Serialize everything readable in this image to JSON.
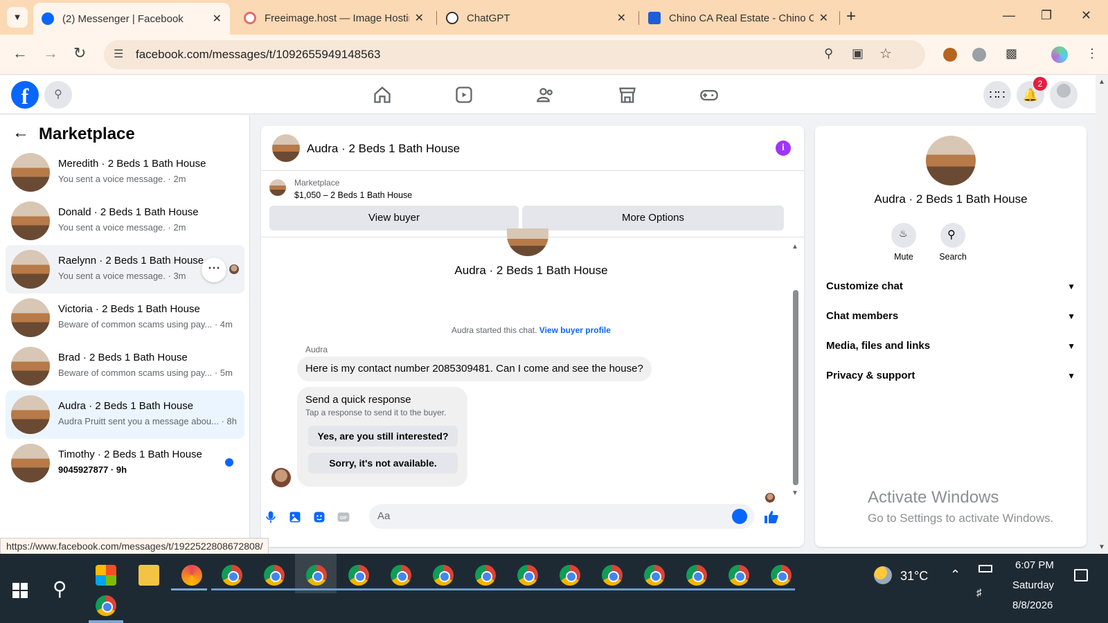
{
  "browser": {
    "tabs": [
      {
        "title": "(2) Messenger | Facebook",
        "active": true
      },
      {
        "title": "Freeimage.host — Image Hostin",
        "active": false
      },
      {
        "title": "ChatGPT",
        "active": false
      },
      {
        "title": "Chino CA Real Estate - Chino CA",
        "active": false
      }
    ],
    "url": "facebook.com/messages/t/1092655949148563",
    "status_url": "https://www.facebook.com/messages/t/1922522808672808/"
  },
  "header": {
    "notification_count": "2"
  },
  "sidebar": {
    "title": "Marketplace",
    "conversations": [
      {
        "name": "Meredith · 2 Beds 1 Bath House",
        "preview": "You sent a voice message. · 2m",
        "unread": false
      },
      {
        "name": "Donald · 2 Beds 1 Bath House",
        "preview": "You sent a voice message. · 2m",
        "unread": false
      },
      {
        "name": "Raelynn · 2 Beds 1 Bath House",
        "preview": "You sent a voice message. · 3m",
        "unread": false
      },
      {
        "name": "Victoria · 2 Beds 1 Bath House",
        "preview": "Beware of common scams using pay... · 4m",
        "unread": false
      },
      {
        "name": "Brad · 2 Beds 1 Bath House",
        "preview": "Beware of common scams using pay... · 5m",
        "unread": false
      },
      {
        "name": "Audra · 2 Beds 1 Bath House",
        "preview": "Audra Pruitt sent you a message abou... · 8h",
        "unread": false
      },
      {
        "name": "Timothy · 2 Beds 1 Bath House",
        "preview": "9045927877 · 9h",
        "unread": true
      }
    ]
  },
  "chat": {
    "title": "Audra · 2 Beds 1 Bath House",
    "marketplace_label": "Marketplace",
    "listing": "$1,050 – 2 Beds 1 Bath House",
    "view_buyer": "View buyer",
    "more_options": "More Options",
    "intro_name": "Audra · 2 Beds 1 Bath House",
    "started_text": "Audra started this chat.",
    "view_buyer_profile": "View buyer profile",
    "sender": "Audra",
    "message": "Here is my contact number 2085309481. Can I come and see the house?",
    "quick_title": "Send a quick response",
    "quick_sub": "Tap a response to send it to the buyer.",
    "quick_options": [
      "Yes, are you still interested?",
      "Sorry, it's not available."
    ],
    "composer_placeholder": "Aa"
  },
  "info_panel": {
    "name": "Audra · 2 Beds 1 Bath House",
    "mute": "Mute",
    "search": "Search",
    "sections": [
      "Customize chat",
      "Chat members",
      "Media, files and links",
      "Privacy & support"
    ]
  },
  "watermark": {
    "line1": "Activate Windows",
    "line2": "Go to Settings to activate Windows."
  },
  "taskbar": {
    "temperature": "31°C",
    "time": "6:07 PM",
    "day": "Saturday",
    "date": "8/8/2026"
  },
  "colors": {
    "facebook_blue": "#0866ff",
    "tab_strip": "#fbd9b4",
    "info_purple": "#a033ff"
  }
}
